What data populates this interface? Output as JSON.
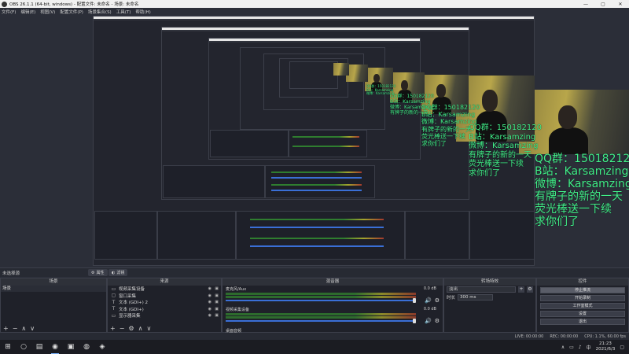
{
  "window": {
    "title": "OBS 26.1.1 (64-bit, windows) - 配置文件: 未命名 - 场景: 未命名",
    "minimize": "—",
    "maximize": "▢",
    "close": "✕"
  },
  "menu": [
    "文件(F)",
    "编辑(E)",
    "视图(V)",
    "配置文件(P)",
    "场景集合(S)",
    "工具(T)",
    "帮助(H)"
  ],
  "overlay_text": {
    "qq": "QQ群：150182120",
    "bilibili": "B站：Karsamzing",
    "weibo": "微博：Karsamzing",
    "line1": "有牌子的新的一天",
    "line2": "荧光棒送一下续",
    "line3": "求你们了"
  },
  "dock_tabs": {
    "selected": "未选择源",
    "properties": "属性",
    "filters": "滤镜"
  },
  "scenes": {
    "header": "场景",
    "items": [
      "场景"
    ],
    "footer": [
      "+",
      "−",
      "∧",
      "∨"
    ]
  },
  "sources": {
    "header": "来源",
    "items": [
      {
        "icon": "▭",
        "icon_name": "video-capture-icon",
        "label": "视频采集设备"
      },
      {
        "icon": "▢",
        "icon_name": "window-capture-icon",
        "label": "窗口采集"
      },
      {
        "icon": "T",
        "icon_name": "text-icon",
        "label": "文本 (GDI+) 2"
      },
      {
        "icon": "T",
        "icon_name": "text-icon",
        "label": "文本 (GDI+)"
      },
      {
        "icon": "▭",
        "icon_name": "display-capture-icon",
        "label": "显示器采集"
      }
    ],
    "footer": [
      "+",
      "−",
      "⚙",
      "∧",
      "∨"
    ]
  },
  "mixer": {
    "header": "混音器",
    "channels": [
      {
        "name": "麦克风/Aux",
        "db": "0.0 dB"
      },
      {
        "name": "视频采集设备",
        "db": "0.0 dB"
      }
    ],
    "third": "桌面音频"
  },
  "transitions": {
    "header": "转场特效",
    "selected": "淡出",
    "duration_label": "时长",
    "duration_value": "300 ms"
  },
  "controls": {
    "header": "控件",
    "buttons": [
      "停止推流",
      "开始录制",
      "工作室模式",
      "设置",
      "退出"
    ]
  },
  "status": {
    "live": "LIVE: 00:00:00",
    "rec": "REC: 00:00:00",
    "cpu": "CPU: 1.1%, 60.00 fps"
  },
  "taskbar": {
    "time": "21:23",
    "date": "2021/6/3"
  }
}
